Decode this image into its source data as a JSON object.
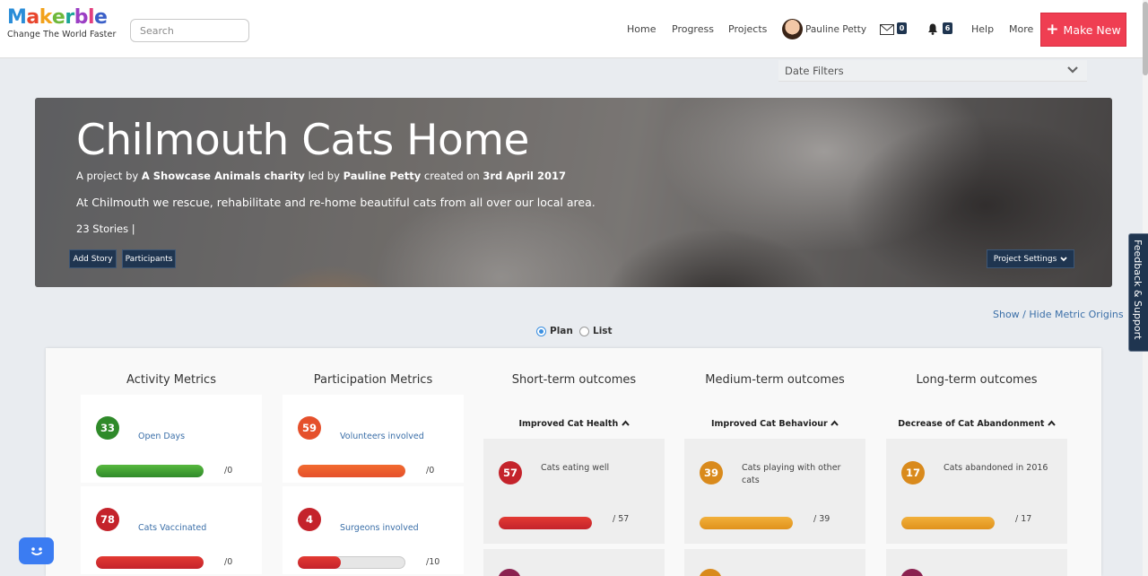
{
  "header": {
    "logo_letters": [
      {
        "ch": "M",
        "color": "#2a8dd8"
      },
      {
        "ch": "a",
        "color": "#e8452c"
      },
      {
        "ch": "k",
        "color": "#f2a21b"
      },
      {
        "ch": "e",
        "color": "#6fb83a"
      },
      {
        "ch": "r",
        "color": "#1ba598"
      },
      {
        "ch": "b",
        "color": "#9b3ec4"
      },
      {
        "ch": "l",
        "color": "#e33f7e"
      },
      {
        "ch": "e",
        "color": "#3a5fc8"
      }
    ],
    "logo_tagline": "Change The World Faster",
    "search_placeholder": "Search",
    "nav": [
      "Home",
      "Progress",
      "Projects"
    ],
    "user_name": "Pauline Petty",
    "messages_count": "0",
    "notifications_count": "6",
    "help": "Help",
    "more": "More",
    "make_new": "Make New",
    "accent": "#ef3e52"
  },
  "date_filters": {
    "label": "Date Filters"
  },
  "project": {
    "title": "Chilmouth Cats Home",
    "byline_prefix": "A project by ",
    "org": "A Showcase Animals charity",
    "byline_led": " led by ",
    "leader": "Pauline Petty",
    "byline_created": " created on ",
    "created": "3rd April 2017",
    "description": "At Chilmouth we rescue, rehabilitate and re-home beautiful cats from all over our local area.",
    "stories": "23 Stories |",
    "add_story": "Add Story",
    "participants": "Participants",
    "settings": "Project Settings"
  },
  "feedback_tab": "Feedback & Support",
  "show_hide_link": "Show / Hide Metric Origins",
  "view_toggle": {
    "plan": "Plan",
    "list": "List",
    "selected": "plan"
  },
  "columns": [
    {
      "title": "Activity Metrics",
      "subheader": "",
      "metrics": [
        {
          "value": "33",
          "label": "Open Days",
          "target": "/0",
          "fill": 1.0,
          "color": "#2f8a2a",
          "bar": "green"
        },
        {
          "value": "78",
          "label": "Cats Vaccinated",
          "target": "/0",
          "fill": 1.0,
          "color": "#c4232b",
          "bar": "red"
        }
      ]
    },
    {
      "title": "Participation Metrics",
      "subheader": "",
      "metrics": [
        {
          "value": "59",
          "label": "Volunteers involved",
          "target": "/0",
          "fill": 1.0,
          "color": "#e5502b",
          "bar": "orange"
        },
        {
          "value": "4",
          "label": "Surgeons involved",
          "target": "/10",
          "fill": 0.4,
          "color": "#c4232b",
          "bar": "red"
        }
      ]
    },
    {
      "title": "Short-term outcomes",
      "subheader": "Improved Cat Health",
      "metrics": [
        {
          "value": "57",
          "label": "Cats eating well",
          "target": "/ 57",
          "fill": 1.0,
          "color": "#c4232b",
          "bar": "red"
        }
      ]
    },
    {
      "title": "Medium-term outcomes",
      "subheader": "Improved Cat Behaviour",
      "metrics": [
        {
          "value": "39",
          "label": "Cats playing with other cats",
          "target": "/ 39",
          "fill": 1.0,
          "color": "#d98a1c",
          "bar": "amber"
        }
      ]
    },
    {
      "title": "Long-term outcomes",
      "subheader": "Decrease of Cat Abandonment",
      "metrics": [
        {
          "value": "17",
          "label": "Cats abandoned in 2016",
          "target": "/ 17",
          "fill": 1.0,
          "color": "#d98a1c",
          "bar": "amber"
        }
      ]
    }
  ]
}
